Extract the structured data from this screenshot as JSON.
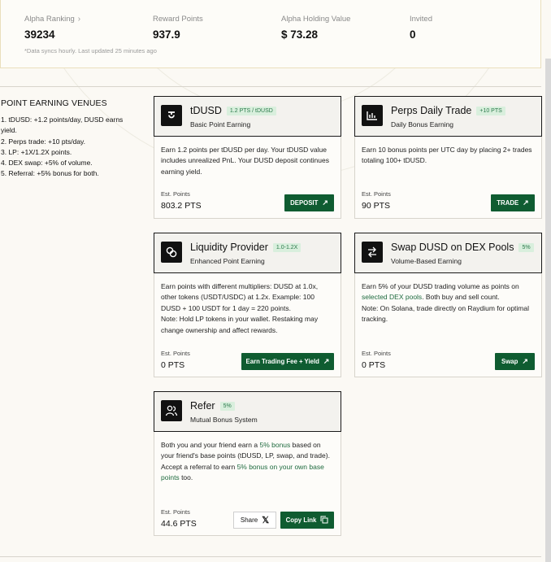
{
  "stats": {
    "ranking_label": "Alpha Ranking",
    "ranking_value": "39234",
    "reward_label": "Reward Points",
    "reward_value": "937.9",
    "holding_label": "Alpha Holding Value",
    "holding_value": "$ 73.28",
    "invited_label": "Invited",
    "invited_value": "0",
    "sync_note": "*Data syncs hourly. Last updated 25 minutes ago"
  },
  "venues": {
    "title": "POINT EARNING VENUES",
    "items": [
      "1. tDUSD: +1.2 points/day, DUSD earns yield.",
      "2. Perps trade: +10 pts/day.",
      "3. LP: +1X/1.2X points.",
      "4. DEX swap: +5% of volume.",
      "5. Referral: +5% bonus for both."
    ]
  },
  "cards": {
    "tdusd": {
      "title": "tDUSD",
      "badge": "1.2 PTS / tDUSD",
      "subtitle": "Basic Point Earning",
      "description": "Earn 1.2 points per tDUSD per day. Your tDUSD value includes unrealized PnL. Your DUSD deposit continues earning yield.",
      "est_label": "Est. Points",
      "est_value": "803.2 PTS",
      "button": "DEPOSIT"
    },
    "perps": {
      "title": "Perps Daily Trade",
      "badge": "+10 PTS",
      "subtitle": "Daily Bonus Earning",
      "description": "Earn 10 bonus points per UTC day by placing 2+ trades totaling 100+ tDUSD.",
      "est_label": "Est. Points",
      "est_value": "90 PTS",
      "button": "TRADE"
    },
    "lp": {
      "title": "Liquidity Provider",
      "badge": "1.0-1.2X",
      "subtitle": "Enhanced Point Earning",
      "description": "Earn points with different multipliers: DUSD at 1.0x, other tokens (USDT/USDC) at 1.2x. Example: 100 DUSD + 100 USDT for 1 day = 220 points.",
      "note": "Note: Hold LP tokens in your wallet. Restaking may change ownership and affect rewards.",
      "est_label": "Est. Points",
      "est_value": "0 PTS",
      "button": "Earn Trading Fee + Yield"
    },
    "swap": {
      "title": "Swap DUSD on DEX Pools",
      "badge": "5%",
      "subtitle": "Volume-Based Earning",
      "desc_pre": "Earn 5% of your DUSD trading volume as points on",
      "desc_link": "selected DEX pools",
      "desc_post": ". Both buy and sell count.",
      "note": "Note: On Solana, trade directly on Raydium for optimal tracking.",
      "est_label": "Est. Points",
      "est_value": "0 PTS",
      "button": "Swap"
    },
    "refer": {
      "title": "Refer",
      "badge": "5%",
      "subtitle": "Mutual Bonus System",
      "desc_pre": "Both you and your friend earn a",
      "desc_link": "5% bonus",
      "desc_post": "based on your friend's base points (tDUSD, LP, swap, and trade).",
      "desc2_pre": "Accept a referral to earn",
      "desc2_link": "5% bonus on your own base points",
      "desc2_post": "too.",
      "est_label": "Est. Points",
      "est_value": "44.6 PTS",
      "share_button": "Share",
      "copy_button": "Copy Link"
    }
  },
  "colors": {
    "accent": "#0f5c31",
    "badge_bg": "#d9efdd",
    "badge_text": "#2b7a4b"
  }
}
